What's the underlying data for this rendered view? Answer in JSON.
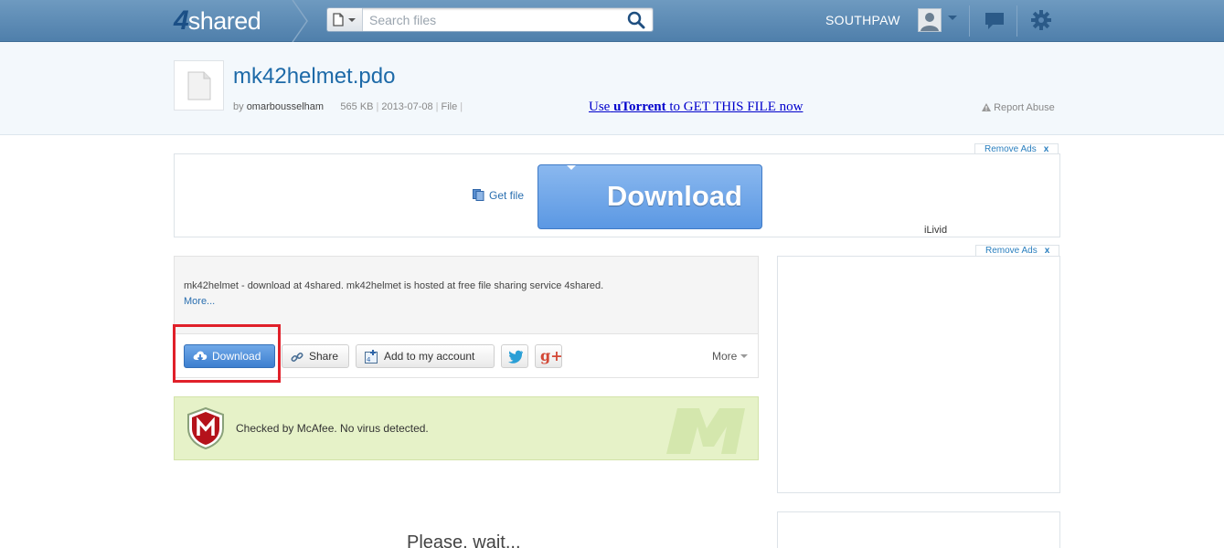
{
  "header": {
    "logo_four": "4",
    "logo_shared": "shared",
    "search_placeholder": "Search files",
    "username": "SOUTHPAW"
  },
  "file": {
    "title": "mk42helmet.pdo",
    "by_label": "by",
    "owner": "omarbousselham",
    "size": "565 KB",
    "date": "2013-07-08",
    "type": "File",
    "utorrent_use": "Use",
    "utorrent_brand": "uTorrent",
    "utorrent_rest": "to GET THIS FILE now",
    "report_abuse": "Report Abuse"
  },
  "ads": {
    "remove_ads": "Remove Ads",
    "remove_x": "x",
    "get_file": "Get file",
    "big_download": "Download",
    "advertiser": "iLivid"
  },
  "description": {
    "text": "mk42helmet - download at 4shared. mk42helmet is hosted at free file sharing service 4shared.",
    "more": "More..."
  },
  "actions": {
    "download": "Download",
    "share": "Share",
    "add_to_account": "Add to my account",
    "more": "More"
  },
  "mcafee": {
    "text": "Checked by McAfee. No virus detected."
  },
  "footer": {
    "please_wait": "Please, wait..."
  },
  "colors": {
    "header_blue": "#5a87b3",
    "link_blue": "#1d6aa8",
    "download_blue": "#5b98e3",
    "highlight_red": "#e0202a",
    "mcafee_green": "#e6f2c8"
  }
}
